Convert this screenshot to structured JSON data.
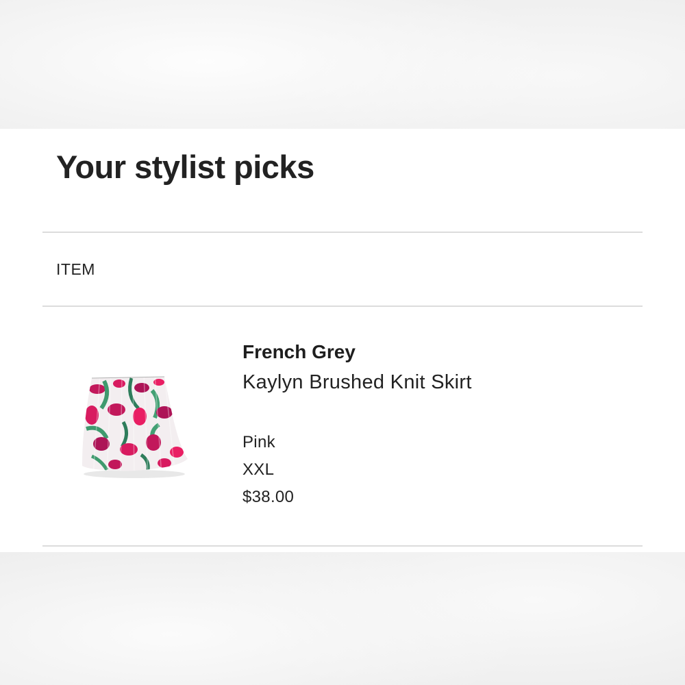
{
  "page": {
    "title": "Your stylist picks"
  },
  "table": {
    "column_header": "ITEM"
  },
  "item": {
    "brand": "French Grey",
    "product_name": "Kaylyn Brushed Knit Skirt",
    "color": "Pink",
    "size": "XXL",
    "price": "$38.00",
    "image": "floral-pleated-skirt-thumbnail"
  },
  "colors": {
    "text": "#222222",
    "divider": "#dcdcdc",
    "skirt_pink": "#c2185b",
    "skirt_green": "#3f9a6e"
  }
}
